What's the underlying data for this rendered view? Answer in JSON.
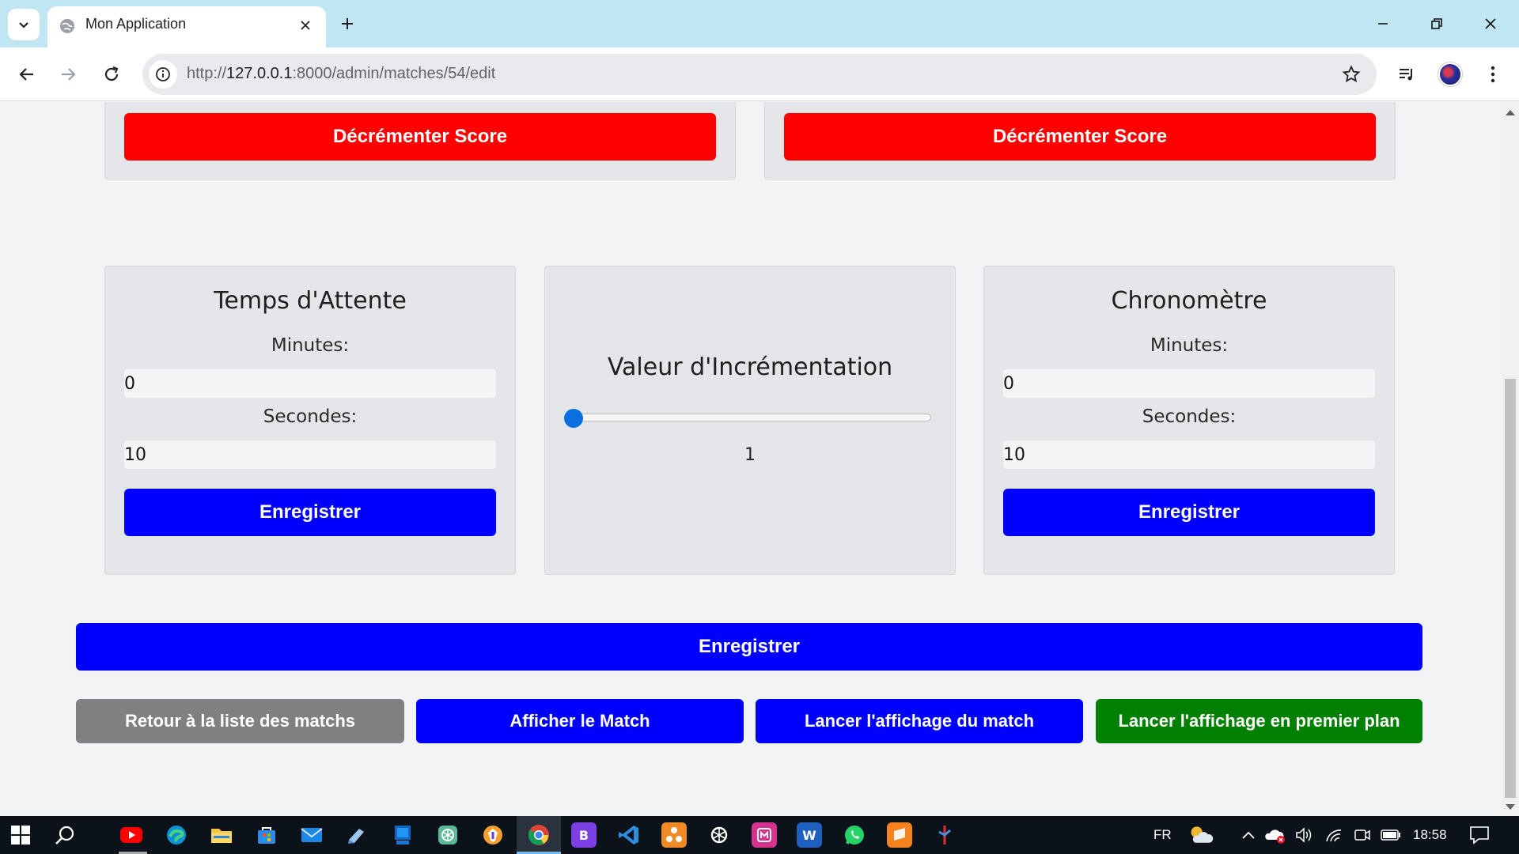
{
  "browser": {
    "tab_title": "Mon Application",
    "url_prefix": "http://",
    "url_host": "127.0.0.1",
    "url_path": ":8000/admin/matches/54/edit"
  },
  "score_cards": [
    {
      "decrement_label": "Décrémenter Score"
    },
    {
      "decrement_label": "Décrémenter Score"
    }
  ],
  "wait_time": {
    "title": "Temps d'Attente",
    "minutes_label": "Minutes:",
    "minutes_value": "0",
    "seconds_label": "Secondes:",
    "seconds_value": "10",
    "save_label": "Enregistrer"
  },
  "increment": {
    "title": "Valeur d'Incrémentation",
    "value": "1",
    "slider_fraction": 0
  },
  "chrono": {
    "title": "Chronomètre",
    "minutes_label": "Minutes:",
    "minutes_value": "0",
    "seconds_label": "Secondes:",
    "seconds_value": "10",
    "save_label": "Enregistrer"
  },
  "main_save_label": "Enregistrer",
  "actions": {
    "back_label": "Retour à la liste des matchs",
    "show_label": "Afficher le Match",
    "launch_label": "Lancer l'affichage du match",
    "launch_front_label": "Lancer l'affichage en premier plan"
  },
  "taskbar": {
    "language": "FR",
    "time": "18:58"
  },
  "colors": {
    "danger": "#ff0000",
    "primary": "#0000ff",
    "secondary": "#808080",
    "success": "#008000"
  }
}
